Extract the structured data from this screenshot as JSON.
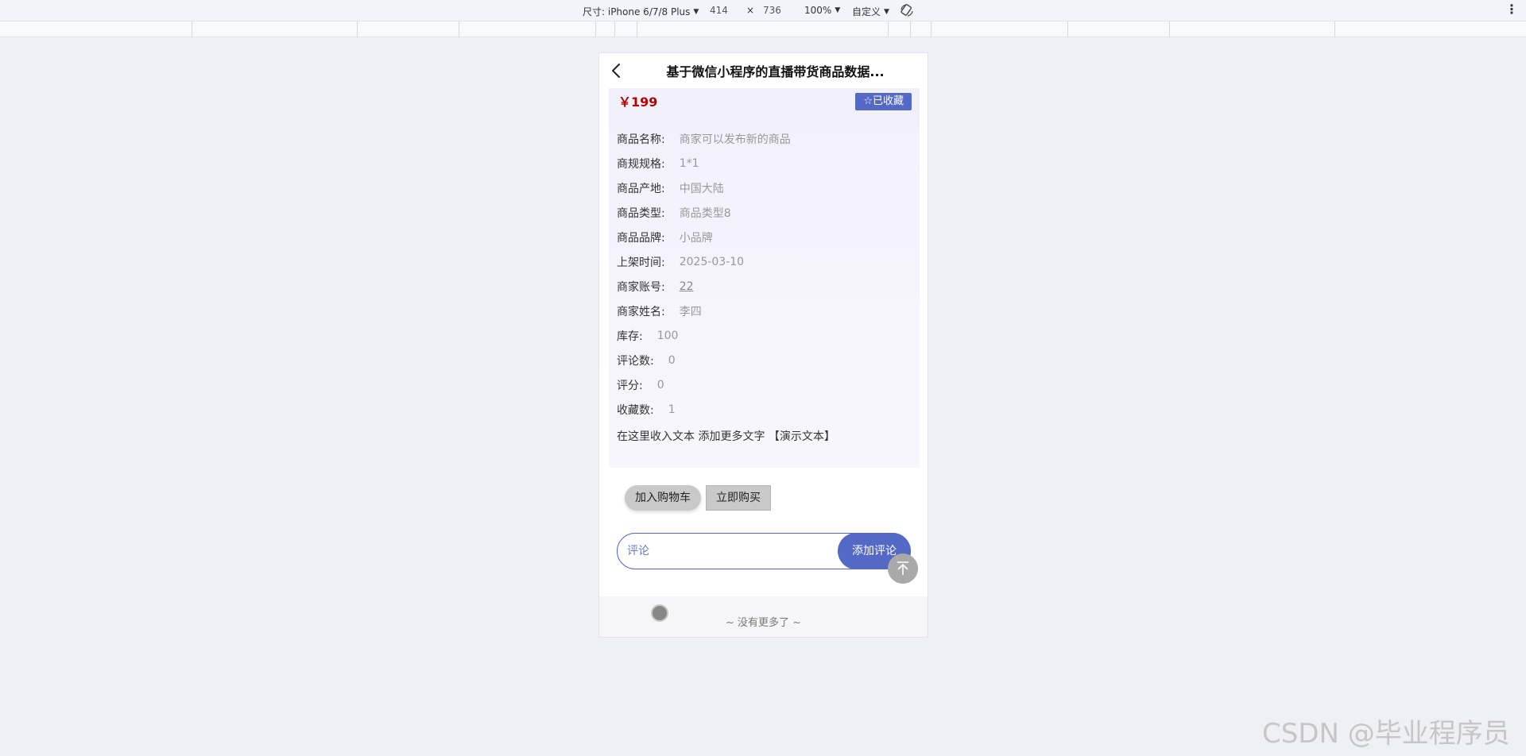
{
  "devtools": {
    "size_label": "尺寸: iPhone 6/7/8 Plus",
    "width": "414",
    "times": "×",
    "height": "736",
    "zoom": "100%",
    "custom": "自定义",
    "rotate_icon": "rotate-icon",
    "menu_icon": "more-vert-icon"
  },
  "nav": {
    "back_icon": "chevron-left-icon",
    "title": "基于微信小程序的直播带货商品数据..."
  },
  "product": {
    "price": "￥199",
    "favorite_label": "☆已收藏",
    "fields": [
      {
        "label": "商品名称:",
        "value": "商家可以发布新的商品"
      },
      {
        "label": "商规规格:",
        "value": "1*1"
      },
      {
        "label": "商品产地:",
        "value": "中国大陆"
      },
      {
        "label": "商品类型:",
        "value": "商品类型8"
      },
      {
        "label": "商品品牌:",
        "value": "小品牌"
      },
      {
        "label": "上架时间:",
        "value": "2025-03-10"
      },
      {
        "label": "商家账号:",
        "value": "22"
      },
      {
        "label": "商家姓名:",
        "value": "李四"
      },
      {
        "label": "库存:",
        "value": "100"
      },
      {
        "label": "评论数:",
        "value": "0"
      },
      {
        "label": "评分:",
        "value": "0"
      },
      {
        "label": "收藏数:",
        "value": "1"
      }
    ],
    "description": "在这里收入文本 添加更多文字 【演示文本】"
  },
  "actions": {
    "add_to_cart": "加入购物车",
    "buy_now": "立即购买"
  },
  "comment": {
    "placeholder": "评论",
    "submit": "添加评论"
  },
  "footer": {
    "no_more": "~ 没有更多了 ~"
  },
  "watermark": "CSDN @毕业程序员",
  "colors": {
    "accent": "#5468c6",
    "price": "#b30000"
  }
}
